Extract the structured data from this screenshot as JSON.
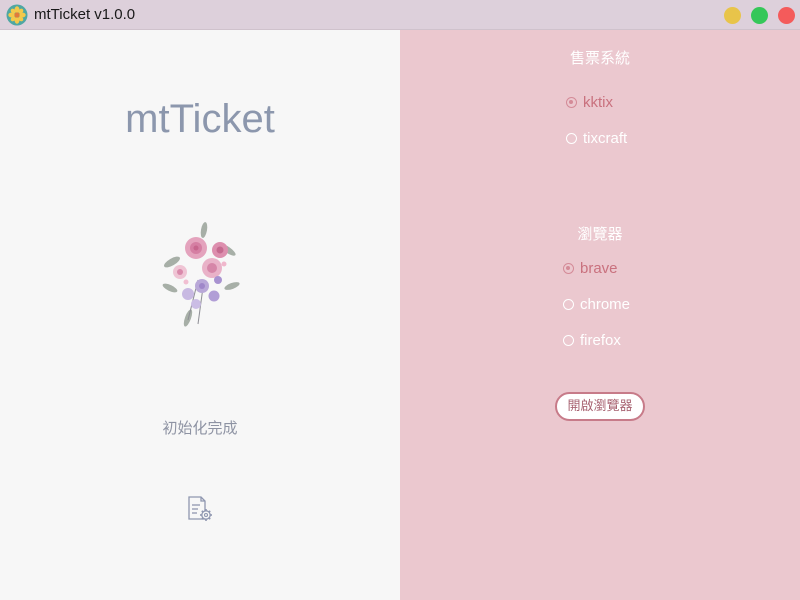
{
  "window": {
    "title": "mtTicket v1.0.0"
  },
  "left": {
    "brand": "mtTicket",
    "status": "初始化完成",
    "settings_icon": "document-gear-icon",
    "bouquet_icon": "flower-bouquet-icon"
  },
  "right": {
    "ticket_system": {
      "title": "售票系統",
      "options": [
        {
          "label": "kktix",
          "checked": true
        },
        {
          "label": "tixcraft",
          "checked": false
        }
      ]
    },
    "browser": {
      "title": "瀏覽器",
      "options": [
        {
          "label": "brave",
          "checked": true
        },
        {
          "label": "chrome",
          "checked": false
        },
        {
          "label": "firefox",
          "checked": false
        }
      ]
    },
    "open_button": "開啟瀏覽器"
  },
  "colors": {
    "titlebar": "#ddd0db",
    "left_bg": "#f7f7f7",
    "right_bg": "#ebc8cf",
    "accent": "#c9717e",
    "brand_text": "#8c97ad",
    "minimize": "#e8c44a",
    "maximize": "#35c759",
    "close": "#f45b5b"
  }
}
